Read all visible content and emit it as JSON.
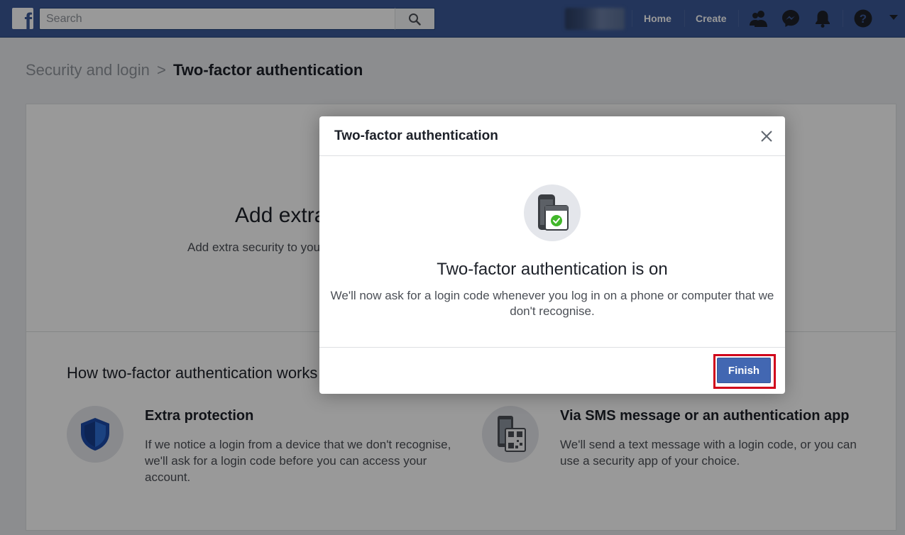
{
  "topbar": {
    "logo_letter": "f",
    "search_placeholder": "Search",
    "nav": {
      "home": "Home",
      "create": "Create"
    }
  },
  "icons": {
    "search": "search-icon",
    "friends": "friends-icon",
    "messenger": "messenger-icon",
    "notifications": "bell-icon",
    "help": "help-icon",
    "menu": "caret-down-icon",
    "close": "close-icon"
  },
  "breadcrumb": {
    "parent": "Security and login",
    "separator": ">",
    "current": "Two-factor authentication"
  },
  "page": {
    "hero_title": "Add extra",
    "hero_subtitle": "Add extra security to you",
    "how_title": "How two-factor authentication works",
    "features": [
      {
        "icon": "shield-icon",
        "title": "Extra protection",
        "desc": "If we notice a login from a device that we don't recognise, we'll ask for a login code before you can access your account."
      },
      {
        "icon": "phone-qr-icon",
        "title": "Via SMS message or an authentication app",
        "desc": "We'll send a text message with a login code, or you can use a security app of your choice."
      }
    ]
  },
  "dialog": {
    "title": "Two-factor authentication",
    "heading": "Two-factor authentication is on",
    "text": "We'll now ask for a login code whenever you log in on a phone or computer that we don't recognise.",
    "finish_label": "Finish"
  },
  "colors": {
    "brand": "#3b5998",
    "button": "#4267b2",
    "highlight": "#d0021b",
    "success": "#42b72a"
  }
}
